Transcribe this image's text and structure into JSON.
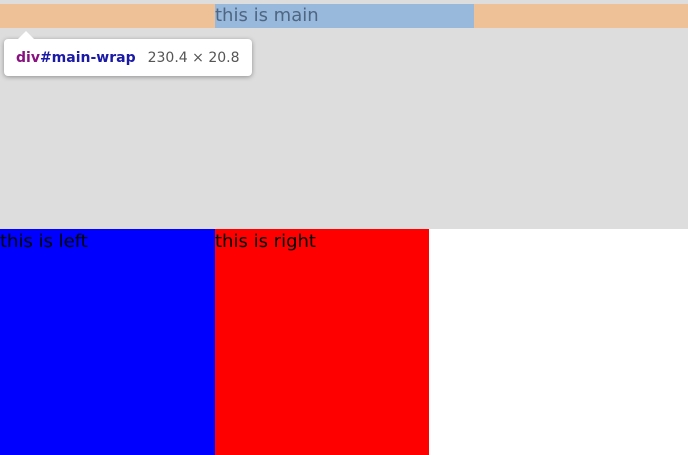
{
  "main": {
    "text": "this is main"
  },
  "inspector_tooltip": {
    "tag": "div",
    "id": "#main-wrap",
    "dimensions": "230.4 × 20.8"
  },
  "left": {
    "text": "this is left",
    "color": "#0000ff"
  },
  "right": {
    "text": "this is right",
    "color": "#ff0000"
  },
  "colors": {
    "container_background": "#dddddd",
    "margin_highlight": "#eec196",
    "content_highlight": "#98b9dc"
  }
}
